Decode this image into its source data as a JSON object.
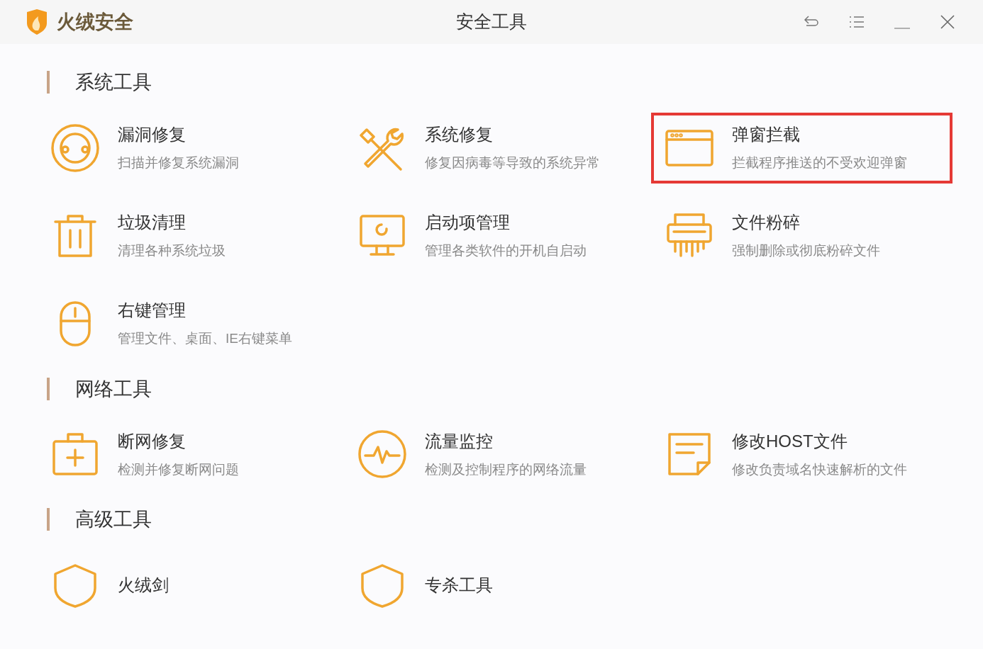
{
  "app": {
    "name": "火绒安全"
  },
  "window": {
    "title": "安全工具"
  },
  "sections": [
    {
      "title": "系统工具",
      "tools": [
        {
          "name": "漏洞修复",
          "description": "扫描并修复系统漏洞",
          "highlighted": false
        },
        {
          "name": "系统修复",
          "description": "修复因病毒等导致的系统异常",
          "highlighted": false
        },
        {
          "name": "弹窗拦截",
          "description": "拦截程序推送的不受欢迎弹窗",
          "highlighted": true
        },
        {
          "name": "垃圾清理",
          "description": "清理各种系统垃圾",
          "highlighted": false
        },
        {
          "name": "启动项管理",
          "description": "管理各类软件的开机自启动",
          "highlighted": false
        },
        {
          "name": "文件粉碎",
          "description": "强制删除或彻底粉碎文件",
          "highlighted": false
        },
        {
          "name": "右键管理",
          "description": "管理文件、桌面、IE右键菜单",
          "highlighted": false
        }
      ]
    },
    {
      "title": "网络工具",
      "tools": [
        {
          "name": "断网修复",
          "description": "检测并修复断网问题",
          "highlighted": false
        },
        {
          "name": "流量监控",
          "description": "检测及控制程序的网络流量",
          "highlighted": false
        },
        {
          "name": "修改HOST文件",
          "description": "修改负责域名快速解析的文件",
          "highlighted": false
        }
      ]
    },
    {
      "title": "高级工具",
      "tools": [
        {
          "name": "火绒剑",
          "highlighted": false
        },
        {
          "name": "专杀工具",
          "highlighted": false
        }
      ]
    }
  ]
}
